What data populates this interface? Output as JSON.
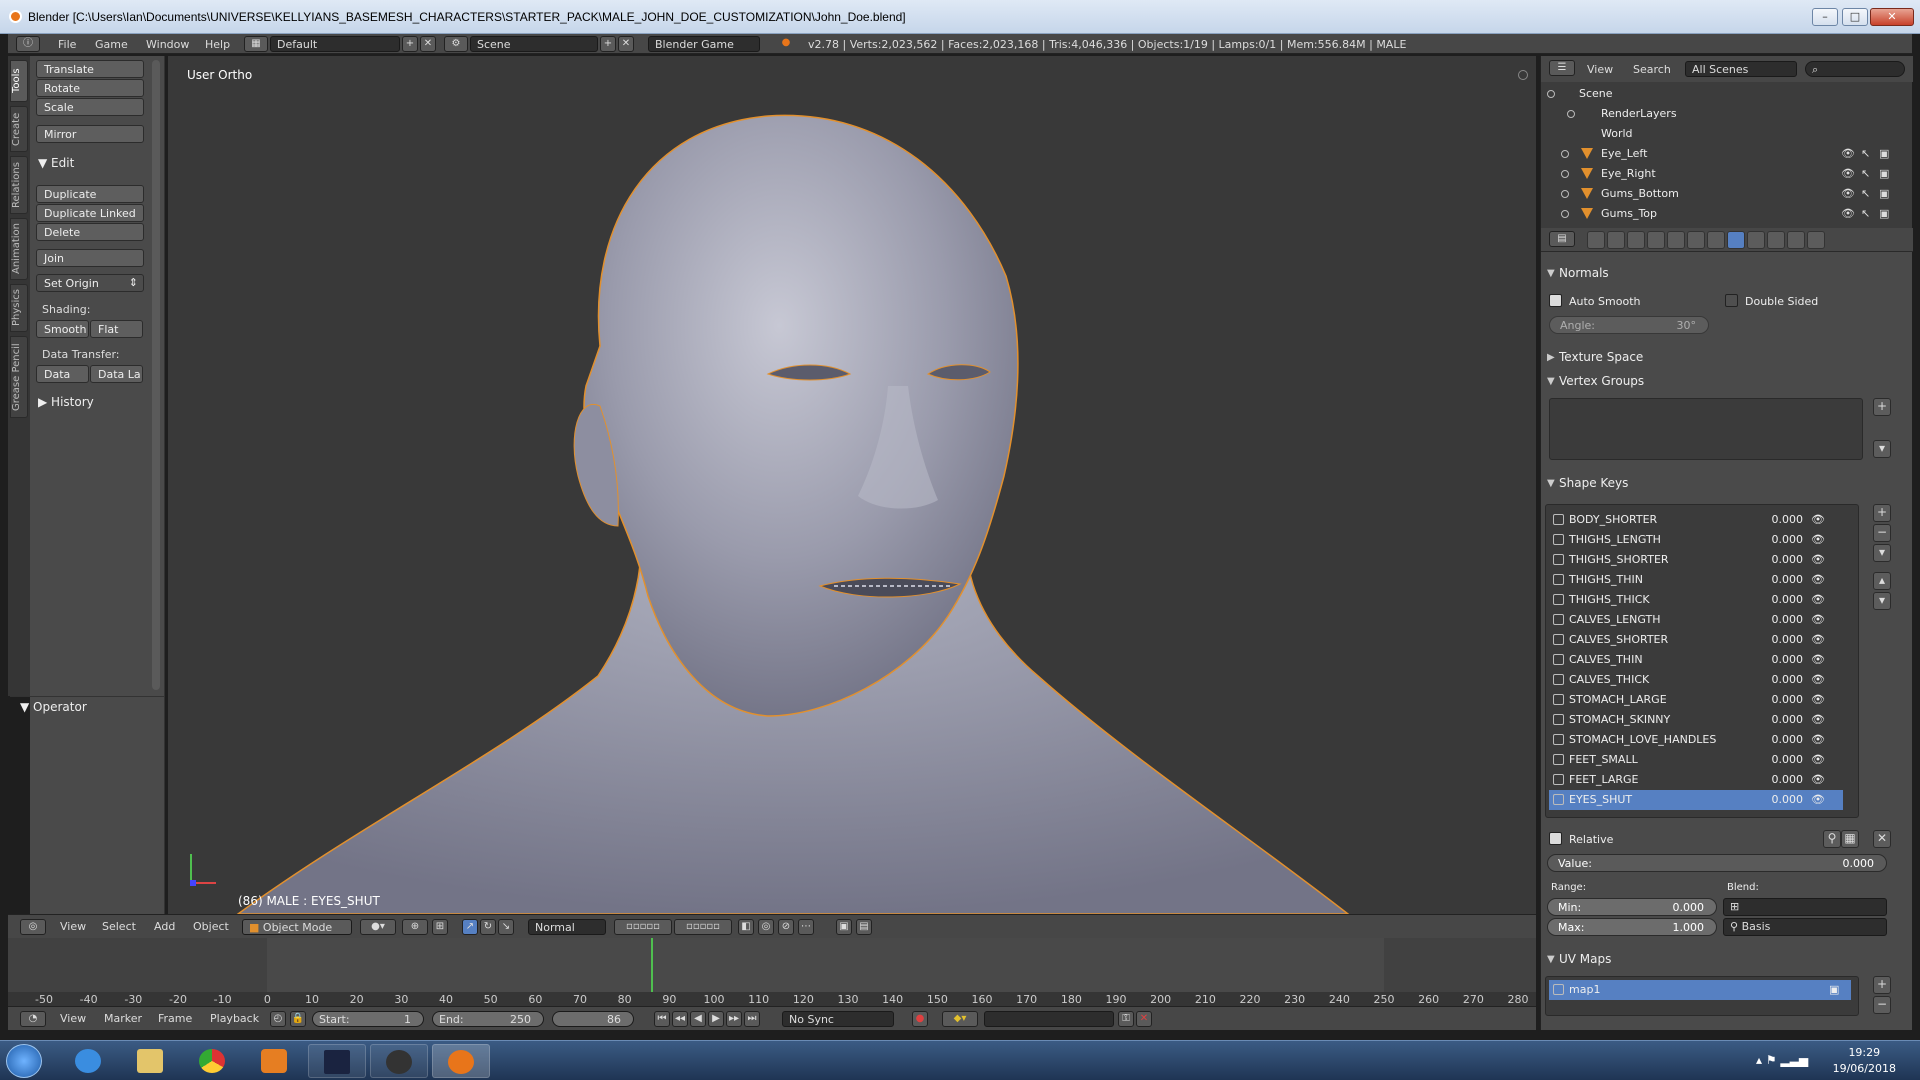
{
  "window": {
    "title": "Blender [C:\\Users\\Ian\\Documents\\UNIVERSE\\KELLYIANS_BASEMESH_CHARACTERS\\STARTER_PACK\\MALE_JOHN_DOE_CUSTOMIZATION\\John_Doe.blend]"
  },
  "info_header": {
    "menus": [
      "File",
      "Game",
      "Window",
      "Help"
    ],
    "layout": "Default",
    "scene": "Scene",
    "engine": "Blender Game",
    "stats": "v2.78 | Verts:2,023,562 | Faces:2,023,168 | Tris:4,046,336 | Objects:1/19 | Lamps:0/1 | Mem:556.84M | MALE"
  },
  "left_tabs": [
    "Tools",
    "Create",
    "Relations",
    "Animation",
    "Physics",
    "Grease Pencil"
  ],
  "tool_shelf": {
    "transform": [
      "Translate",
      "Rotate",
      "Scale"
    ],
    "mirror": "Mirror",
    "edit_section": "Edit",
    "edit": [
      "Duplicate",
      "Duplicate Linked",
      "Delete"
    ],
    "join": "Join",
    "set_origin": "Set Origin",
    "shading_label": "Shading:",
    "smooth": "Smooth",
    "flat": "Flat",
    "data_transfer_label": "Data Transfer:",
    "data": "Data",
    "data_layout": "Data La",
    "history_section": "History",
    "operator_section": "Operator"
  },
  "viewport": {
    "view_label": "User Ortho",
    "status": "(86) MALE : EYES_SHUT"
  },
  "viewport_header": {
    "menus": [
      "View",
      "Select",
      "Add",
      "Object"
    ],
    "mode": "Object Mode",
    "orientation": "Normal"
  },
  "timeline": {
    "ticks": [
      "-50",
      "-40",
      "-30",
      "-20",
      "-10",
      "0",
      "10",
      "20",
      "30",
      "40",
      "50",
      "60",
      "70",
      "80",
      "90",
      "100",
      "110",
      "120",
      "130",
      "140",
      "150",
      "160",
      "170",
      "180",
      "190",
      "200",
      "210",
      "220",
      "230",
      "240",
      "250",
      "260",
      "270",
      "280"
    ],
    "current_frame": 86,
    "menus": [
      "View",
      "Marker",
      "Frame",
      "Playback"
    ],
    "start_label": "Start:",
    "start": "1",
    "end_label": "End:",
    "end": "250",
    "frame": "86",
    "sync": "No Sync"
  },
  "outliner": {
    "menus": [
      "View",
      "Search"
    ],
    "filter": "All Scenes",
    "items": [
      {
        "label": "Scene",
        "type": "scene"
      },
      {
        "label": "RenderLayers",
        "type": "renderlayers"
      },
      {
        "label": "World",
        "type": "world"
      },
      {
        "label": "Eye_Left",
        "type": "mesh"
      },
      {
        "label": "Eye_Right",
        "type": "mesh"
      },
      {
        "label": "Gums_Bottom",
        "type": "mesh"
      },
      {
        "label": "Gums_Top",
        "type": "mesh"
      }
    ]
  },
  "properties": {
    "normals": {
      "title": "Normals",
      "auto_smooth": "Auto Smooth",
      "double_sided": "Double Sided",
      "angle_label": "Angle:",
      "angle_value": "30°"
    },
    "texture_space": "Texture Space",
    "vertex_groups": "Vertex Groups",
    "shape_keys": {
      "title": "Shape Keys",
      "items": [
        {
          "name": "BODY_SHORTER",
          "value": "0.000"
        },
        {
          "name": "THIGHS_LENGTH",
          "value": "0.000"
        },
        {
          "name": "THIGHS_SHORTER",
          "value": "0.000"
        },
        {
          "name": "THIGHS_THIN",
          "value": "0.000"
        },
        {
          "name": "THIGHS_THICK",
          "value": "0.000"
        },
        {
          "name": "CALVES_LENGTH",
          "value": "0.000"
        },
        {
          "name": "CALVES_SHORTER",
          "value": "0.000"
        },
        {
          "name": "CALVES_THIN",
          "value": "0.000"
        },
        {
          "name": "CALVES_THICK",
          "value": "0.000"
        },
        {
          "name": "STOMACH_LARGE",
          "value": "0.000"
        },
        {
          "name": "STOMACH_SKINNY",
          "value": "0.000"
        },
        {
          "name": "STOMACH_LOVE_HANDLES",
          "value": "0.000"
        },
        {
          "name": "FEET_SMALL",
          "value": "0.000"
        },
        {
          "name": "FEET_LARGE",
          "value": "0.000"
        },
        {
          "name": "EYES_SHUT",
          "value": "0.000"
        }
      ],
      "selected": 14,
      "relative": "Relative",
      "value_label": "Value:",
      "value": "0.000",
      "range_label": "Range:",
      "blend_label": "Blend:",
      "min_label": "Min:",
      "min": "0.000",
      "max_label": "Max:",
      "max": "1.000",
      "blend_value": "Basis"
    },
    "uv_maps": {
      "title": "UV Maps",
      "item": "map1"
    }
  },
  "taskbar": {
    "time": "19:29",
    "date": "19/06/2018"
  },
  "colors": {
    "selection": "#5680c2",
    "outline": "#e2902d",
    "frame_cursor": "#4fbf4f"
  }
}
